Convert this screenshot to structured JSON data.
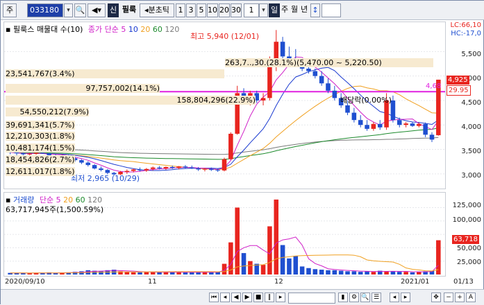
{
  "toolbar": {
    "market": "주",
    "code": "033180",
    "sin": "신",
    "stock_name": "필룩",
    "period_label": "◂분초틱",
    "periods": [
      "1",
      "3",
      "5",
      "10",
      "20",
      "30"
    ],
    "interval": "1",
    "units": [
      "일",
      "주",
      "월",
      "년"
    ],
    "arrow": "↕"
  },
  "legend": {
    "bullet": "▪",
    "main": "필룩스 매물대 수(10)",
    "ma_label": "종가 단순",
    "ma_periods": [
      "5",
      "10",
      "20",
      "60",
      "120"
    ]
  },
  "right_info": {
    "lc": "LC:66,10",
    "hc": "HC:-17,0"
  },
  "price_axis": [
    "5,500",
    "5,000",
    "4,500",
    "4,000",
    "3,500",
    "3,000"
  ],
  "price_tags": {
    "last": "4,925",
    "pct": "29.95",
    "line": "4,68"
  },
  "annotations": {
    "high": "최고 5,940 (12/01)",
    "low": "최저 2,965 (10/29)",
    "range": "263,7..,30.(28.1%)(5,470.00 ~ 5,220.50)",
    "dividend": "배당락(0.00%)"
  },
  "volume_profile": [
    "23,541,767(3.4%)",
    "97,757,002(14.1%)",
    "158,804,296(22.9%)",
    "54,550,212(7.9%)",
    "39,691,341(5.7%)",
    "12,210,303(1.8%)",
    "10,481,174(1.5%)",
    "18,454,826(2.7%)",
    "12,611,017(1.8%)"
  ],
  "vol_legend": {
    "title": "거래량",
    "ma_label": "단순",
    "ma_periods": [
      "5",
      "20",
      "60",
      "120"
    ],
    "value": "63,717,945주(1,500.59%)"
  },
  "vol_axis": [
    "125,000",
    "100,000",
    "75,000",
    "50,000",
    "25,000"
  ],
  "vol_tag": "63,718",
  "dates": [
    "2020/09/10",
    "11",
    "12",
    "2021/01",
    "01/13"
  ],
  "colors": {
    "up": "#e8251f",
    "down": "#1f4fd0",
    "ma5": "#d020c8",
    "ma10": "#1a3ad0",
    "ma20": "#f0a020",
    "ma60": "#1c8a2c",
    "ma120": "#7a7a7a",
    "hline": "#e020e0"
  },
  "chart_data": {
    "type": "candlestick",
    "title": "필룩스 (033180)",
    "ylim": [
      2700,
      6100
    ],
    "candles": [
      [
        3450,
        3480,
        3400,
        3440
      ],
      [
        3440,
        3460,
        3380,
        3420
      ],
      [
        3420,
        3440,
        3360,
        3400
      ],
      [
        3400,
        3430,
        3370,
        3410
      ],
      [
        3410,
        3450,
        3390,
        3430
      ],
      [
        3430,
        3460,
        3410,
        3420
      ],
      [
        3420,
        3430,
        3350,
        3370
      ],
      [
        3370,
        3400,
        3340,
        3360
      ],
      [
        3360,
        3390,
        3330,
        3380
      ],
      [
        3380,
        3400,
        3300,
        3320
      ],
      [
        3320,
        3340,
        3250,
        3280
      ],
      [
        3280,
        3300,
        3200,
        3230
      ],
      [
        3230,
        3260,
        3150,
        3180
      ],
      [
        3180,
        3200,
        3090,
        3110
      ],
      [
        3110,
        3150,
        3050,
        3080
      ],
      [
        3080,
        3100,
        2990,
        3020
      ],
      [
        3020,
        3040,
        2965,
        2990
      ],
      [
        2990,
        3060,
        2975,
        3040
      ],
      [
        3040,
        3090,
        3000,
        3060
      ],
      [
        3060,
        3110,
        3030,
        3090
      ],
      [
        3090,
        3130,
        3050,
        3070
      ],
      [
        3070,
        3120,
        3040,
        3100
      ],
      [
        3100,
        3150,
        3070,
        3130
      ],
      [
        3130,
        3160,
        3090,
        3110
      ],
      [
        3110,
        3150,
        3080,
        3140
      ],
      [
        3140,
        3170,
        3100,
        3120
      ],
      [
        3120,
        3160,
        3090,
        3150
      ],
      [
        3150,
        3180,
        3110,
        3130
      ],
      [
        3130,
        3170,
        3100,
        3110
      ],
      [
        3110,
        3140,
        3060,
        3090
      ],
      [
        3090,
        3120,
        3050,
        3100
      ],
      [
        3100,
        3130,
        3060,
        3080
      ],
      [
        3080,
        3110,
        3040,
        3070
      ],
      [
        3070,
        3330,
        3050,
        3300
      ],
      [
        3300,
        3850,
        3280,
        3820
      ],
      [
        3820,
        4800,
        3800,
        4650
      ],
      [
        4650,
        4750,
        4450,
        4500
      ],
      [
        4500,
        4700,
        4400,
        4650
      ],
      [
        4650,
        4700,
        4450,
        4500
      ],
      [
        4500,
        4650,
        4400,
        4550
      ],
      [
        4550,
        5400,
        4500,
        5200
      ],
      [
        5200,
        5940,
        5100,
        5700
      ],
      [
        5700,
        5800,
        5300,
        5400
      ],
      [
        5400,
        5600,
        5250,
        5350
      ],
      [
        5350,
        5550,
        5200,
        5300
      ],
      [
        5300,
        5350,
        5100,
        5150
      ],
      [
        5150,
        5350,
        5050,
        5100
      ],
      [
        5100,
        5150,
        4950,
        5000
      ],
      [
        5000,
        5100,
        4800,
        4850
      ],
      [
        4850,
        4950,
        4650,
        4700
      ],
      [
        4700,
        4800,
        4500,
        4550
      ],
      [
        4550,
        4650,
        4350,
        4400
      ],
      [
        4400,
        4500,
        4200,
        4250
      ],
      [
        4250,
        4350,
        4050,
        4100
      ],
      [
        4100,
        4200,
        3950,
        4000
      ],
      [
        4000,
        4100,
        3880,
        3920
      ],
      [
        3920,
        4060,
        3880,
        4020
      ],
      [
        4020,
        4100,
        3900,
        3950
      ],
      [
        3950,
        4650,
        3900,
        4500
      ],
      [
        4500,
        4600,
        4050,
        4100
      ],
      [
        4100,
        4150,
        3950,
        4000
      ],
      [
        4000,
        4060,
        3950,
        4030
      ],
      [
        4030,
        4060,
        3960,
        3980
      ],
      [
        3980,
        4050,
        3950,
        4020
      ],
      [
        4020,
        4050,
        3750,
        3800
      ],
      [
        3800,
        3850,
        3650,
        3700
      ],
      [
        3790,
        4925,
        3780,
        4925
      ]
    ],
    "volume": [
      3,
      3,
      3,
      2,
      3,
      3,
      4,
      3,
      3,
      4,
      5,
      6,
      8,
      7,
      6,
      8,
      9,
      6,
      5,
      4,
      4,
      5,
      5,
      4,
      4,
      4,
      5,
      4,
      4,
      4,
      5,
      4,
      5,
      20,
      60,
      125,
      40,
      25,
      20,
      18,
      90,
      140,
      55,
      30,
      35,
      15,
      12,
      10,
      9,
      8,
      8,
      7,
      6,
      6,
      5,
      6,
      5,
      7,
      6,
      6,
      5,
      5,
      4,
      5,
      6,
      7,
      64
    ],
    "volume_unit": "thousand shares",
    "series": [
      {
        "name": "종가 단순 5"
      },
      {
        "name": "10"
      },
      {
        "name": "20"
      },
      {
        "name": "60"
      },
      {
        "name": "120"
      }
    ]
  }
}
